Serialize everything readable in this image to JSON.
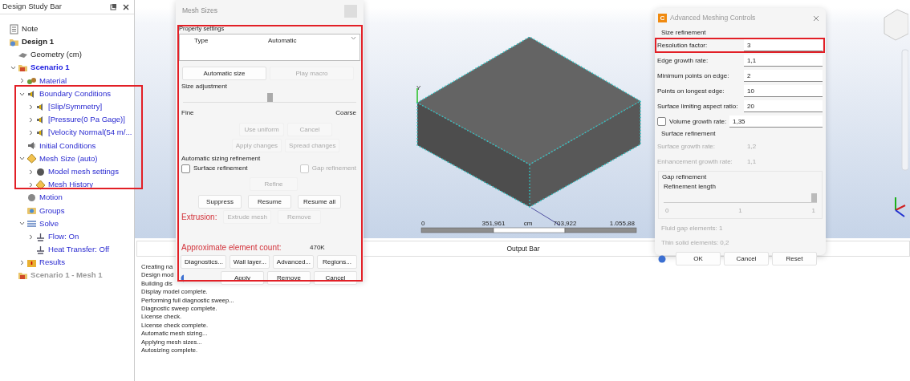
{
  "study_bar": {
    "title": "Design Study Bar",
    "tree": [
      {
        "label": "Note",
        "kind": "note"
      },
      {
        "label": "Design 1",
        "kind": "design",
        "children": [
          {
            "label": "Geometry (cm)",
            "kind": "geometry"
          },
          {
            "label": "Scenario 1",
            "kind": "scenario",
            "expanded": true,
            "children": [
              {
                "label": "Material",
                "kind": "material",
                "expanded": false
              },
              {
                "label": "Boundary Conditions",
                "kind": "boundary",
                "expanded": true,
                "children": [
                  {
                    "label": "[Slip/Symmetry]",
                    "kind": "boundary",
                    "expanded": false
                  },
                  {
                    "label": "[Pressure(0 Pa Gage)]",
                    "kind": "boundary",
                    "expanded": false
                  },
                  {
                    "label": "[Velocity Normal(54 m/...",
                    "kind": "boundary",
                    "expanded": false
                  }
                ]
              },
              {
                "label": "Initial Conditions",
                "kind": "initial"
              },
              {
                "label": "Mesh Size (auto)",
                "kind": "mesh",
                "expanded": true,
                "children": [
                  {
                    "label": "Model mesh settings",
                    "kind": "settings",
                    "expanded": false
                  },
                  {
                    "label": "Mesh History",
                    "kind": "mesh",
                    "expanded": false
                  }
                ]
              },
              {
                "label": "Motion",
                "kind": "motion"
              },
              {
                "label": "Groups",
                "kind": "groups"
              },
              {
                "label": "Solve",
                "kind": "solve",
                "expanded": true,
                "children": [
                  {
                    "label": "Flow: On",
                    "kind": "flow",
                    "expanded": false
                  },
                  {
                    "label": "Heat Transfer: Off",
                    "kind": "flow"
                  }
                ]
              },
              {
                "label": "Results",
                "kind": "results",
                "expanded": false
              }
            ]
          },
          {
            "label": "Scenario 1 - Mesh 1",
            "kind": "inactive"
          }
        ]
      }
    ]
  },
  "viewport": {
    "axis_label": "Y",
    "scale_labels": [
      "0",
      "351,961",
      "703,922",
      "1.055,88"
    ],
    "scale_unit": "cm"
  },
  "output_bar": {
    "title": "Output Bar",
    "lines": [
      "Creating na",
      "Design mod",
      "Building dis",
      "Display model complete.",
      "Performing full diagnostic sweep...",
      "Diagnostic sweep complete.",
      "License check.",
      "License check complete.",
      "Automatic mesh sizing...",
      "Applying mesh sizes...",
      "Autosizing complete."
    ]
  },
  "mesh_sizes": {
    "title": "Mesh Sizes",
    "section": "Property settings",
    "property": {
      "name": "Type",
      "value": "Automatic"
    },
    "top_buttons": [
      {
        "label": "Automatic size",
        "disabled": false
      },
      {
        "label": "Play macro",
        "disabled": true
      }
    ],
    "size_adjustment": {
      "label": "Size adjustment",
      "level": 0.5,
      "min_label": "Fine",
      "max_label": "Coarse"
    },
    "adjust_buttons": [
      [
        {
          "label": "Use uniform",
          "disabled": true
        },
        {
          "label": "Cancel",
          "disabled": true
        }
      ],
      [
        {
          "label": "Apply changes",
          "disabled": true
        },
        {
          "label": "Spread changes",
          "disabled": true
        }
      ]
    ],
    "refinement": {
      "title": "Automatic sizing refinement",
      "checks": [
        {
          "label": "Surface refinement",
          "checked": false,
          "disabled": false
        },
        {
          "label": "Gap refinement",
          "checked": false,
          "disabled": true
        }
      ],
      "button": {
        "label": "Refine",
        "disabled": true
      }
    },
    "history_buttons": [
      {
        "label": "Suppress",
        "disabled": false
      },
      {
        "label": "Resume",
        "disabled": false
      },
      {
        "label": "Resume all",
        "disabled": false
      }
    ],
    "extrusion": {
      "label": "Extrusion:",
      "buttons": [
        {
          "label": "Extrude mesh",
          "disabled": true
        },
        {
          "label": "Remove",
          "disabled": true
        }
      ]
    },
    "count": {
      "label": "Approximate element count:",
      "value": "470K"
    },
    "tool_buttons": [
      {
        "label": "Diagnostics...",
        "disabled": false
      },
      {
        "label": "Wall layer...",
        "disabled": false
      },
      {
        "label": "Advanced...",
        "disabled": false
      },
      {
        "label": "Regions...",
        "disabled": false
      }
    ],
    "footer_buttons": [
      {
        "label": "Apply",
        "disabled": false
      },
      {
        "label": "Remove",
        "disabled": false
      },
      {
        "label": "Cancel",
        "disabled": false
      }
    ]
  },
  "advanced": {
    "logo": "C",
    "title": "Advanced Meshing Controls",
    "size_section": "Size refinement",
    "size_fields": [
      {
        "label": "Resolution factor:",
        "value": "3",
        "disabled": false
      },
      {
        "label": "Edge growth rate:",
        "value": "1,1",
        "disabled": false
      },
      {
        "label": "Minimum points on edge:",
        "value": "2",
        "disabled": false
      },
      {
        "label": "Points on longest edge:",
        "value": "10",
        "disabled": false
      },
      {
        "label": "Surface limiting aspect ratio:",
        "value": "20",
        "disabled": false
      }
    ],
    "volume": {
      "label": "Volume growth rate:",
      "value": "1,35",
      "checked": false
    },
    "surface_section": "Surface refinement",
    "surface_fields": [
      {
        "label": "Surface growth rate:",
        "value": "1,2",
        "disabled": true
      },
      {
        "label": "Enhancement growth rate:",
        "value": "1,1",
        "disabled": true
      }
    ],
    "gap": {
      "title": "Gap refinement",
      "slider_label": "Refinement length",
      "level": 1,
      "ticks": [
        "0",
        "1",
        "1"
      ]
    },
    "info": [
      "Fluid gap elements: 1",
      "Thin solid elements: 0,2"
    ],
    "buttons": [
      "OK",
      "Cancel",
      "Reset"
    ]
  }
}
